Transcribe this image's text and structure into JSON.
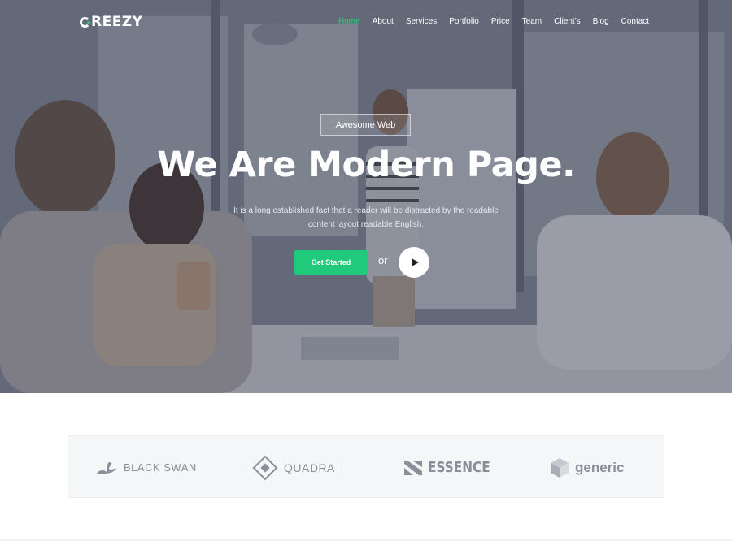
{
  "brand": {
    "logo_text": "REEZY",
    "accent": "#21c97a"
  },
  "nav": {
    "items": [
      {
        "label": "Home",
        "active": true
      },
      {
        "label": "About"
      },
      {
        "label": "Services"
      },
      {
        "label": "Portfolio"
      },
      {
        "label": "Price"
      },
      {
        "label": "Team"
      },
      {
        "label": "Client's"
      },
      {
        "label": "Blog"
      },
      {
        "label": "Contact"
      }
    ]
  },
  "hero": {
    "badge": "Awesome Web",
    "headline": "We Are Modern Page.",
    "subtext_line1": "It is a long established fact that a reader will be distracted by the readable",
    "subtext_line2": "content layout readable English.",
    "cta_label": "Get Started",
    "or_label": "or",
    "play_icon": "play-icon"
  },
  "clients": [
    {
      "name": "BLACK SWAN",
      "icon": "swan-icon"
    },
    {
      "name": "QUADRA",
      "icon": "diamond-icon"
    },
    {
      "name": "ESSENCE",
      "icon": "essence-icon"
    },
    {
      "name": "generic",
      "icon": "cube-icon"
    }
  ]
}
